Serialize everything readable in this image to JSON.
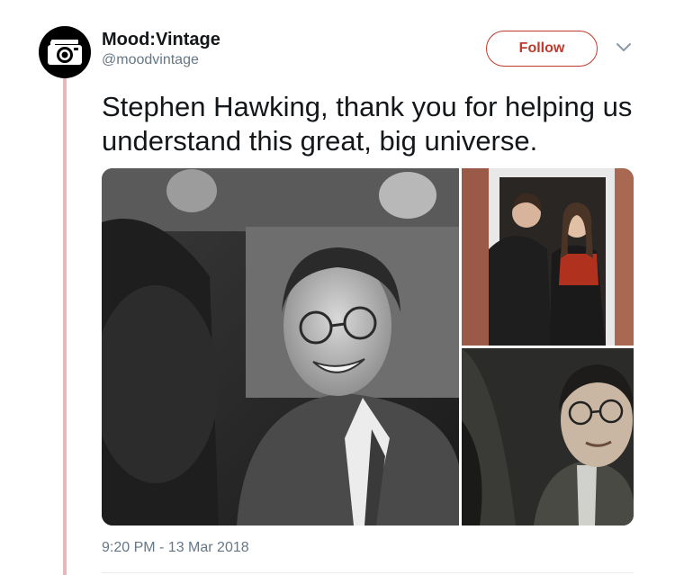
{
  "account": {
    "display_name": "Mood:Vintage",
    "handle": "@moodvintage",
    "avatar_icon": "camera-icon"
  },
  "follow_button": {
    "label": "Follow"
  },
  "more_menu": {
    "icon": "chevron-down-icon"
  },
  "tweet": {
    "text": "Stephen Hawking, thank you for helping us understand this great, big universe.",
    "timestamp": "9:20 PM - 13 Mar 2018"
  },
  "media": {
    "photos": [
      {
        "name": "black and white portrait, smiling man in glasses and tweed jacket"
      },
      {
        "name": "colour photo, young couple standing in a doorway"
      },
      {
        "name": "colour close-up, man in glasses in a leather chair"
      }
    ]
  },
  "colors": {
    "accent": "#c0392b",
    "thread_line": "#e8b7b7",
    "secondary_text": "#657786",
    "primary_text": "#14171a"
  }
}
